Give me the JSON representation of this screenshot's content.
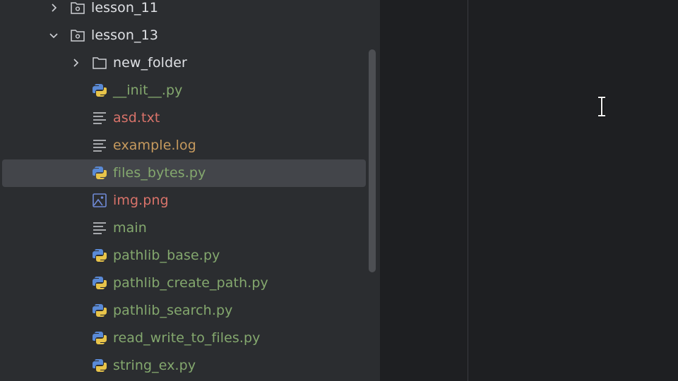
{
  "project_tree": {
    "items": [
      {
        "label": "lesson_11",
        "type": "module-folder",
        "expanded": false,
        "depth": 0,
        "selected": false
      },
      {
        "label": "lesson_13",
        "type": "module-folder",
        "expanded": true,
        "depth": 0,
        "selected": false
      },
      {
        "label": "new_folder",
        "type": "folder",
        "expanded": false,
        "depth": 1,
        "selected": false
      },
      {
        "label": "__init__.py",
        "type": "python",
        "depth": 1,
        "selected": false
      },
      {
        "label": "asd.txt",
        "type": "text",
        "depth": 1,
        "selected": false
      },
      {
        "label": "example.log",
        "type": "log",
        "depth": 1,
        "selected": false
      },
      {
        "label": "files_bytes.py",
        "type": "python",
        "depth": 1,
        "selected": true
      },
      {
        "label": "img.png",
        "type": "image",
        "depth": 1,
        "selected": false
      },
      {
        "label": "main",
        "type": "text",
        "depth": 1,
        "selected": false
      },
      {
        "label": "pathlib_base.py",
        "type": "python",
        "depth": 1,
        "selected": false
      },
      {
        "label": "pathlib_create_path.py",
        "type": "python",
        "depth": 1,
        "selected": false
      },
      {
        "label": "pathlib_search.py",
        "type": "python",
        "depth": 1,
        "selected": false
      },
      {
        "label": "read_write_to_files.py",
        "type": "python",
        "depth": 1,
        "selected": false
      },
      {
        "label": "string_ex.py",
        "type": "python",
        "depth": 1,
        "selected": false
      }
    ]
  },
  "colors": {
    "panel_bg": "#2b2d30",
    "editor_bg": "#1e1f22",
    "selection_bg": "#43454a",
    "python_file": "#84a86e",
    "text_file_modified": "#d9736a",
    "log_file": "#c69a5e",
    "folder_text": "#dfe1e5"
  }
}
